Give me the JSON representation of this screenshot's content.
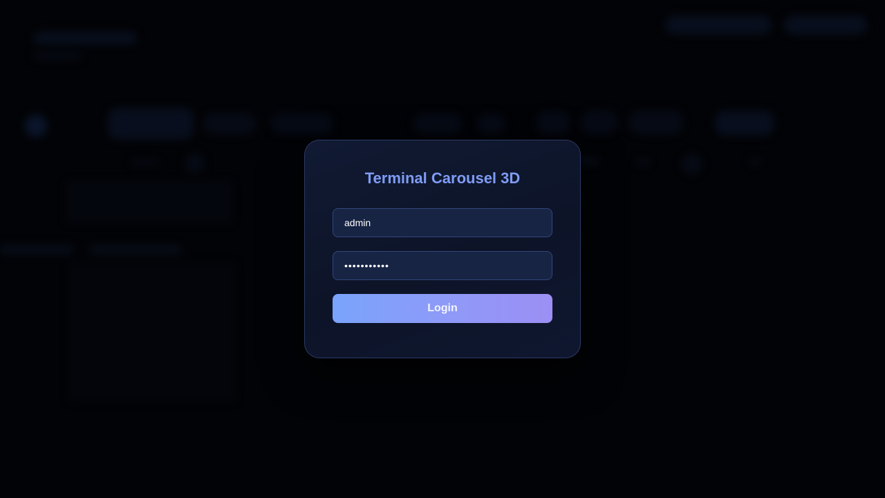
{
  "login": {
    "title": "Terminal Carousel 3D",
    "username_value": "admin",
    "password_mask": "•••••••••••",
    "submit_label": "Login"
  },
  "colors": {
    "background": "#020306",
    "modal_border": "#2c3b66",
    "title_accent": "#7f9cf5",
    "button_gradient_start": "#7aa4fb",
    "button_gradient_end": "#9c8ff4"
  }
}
